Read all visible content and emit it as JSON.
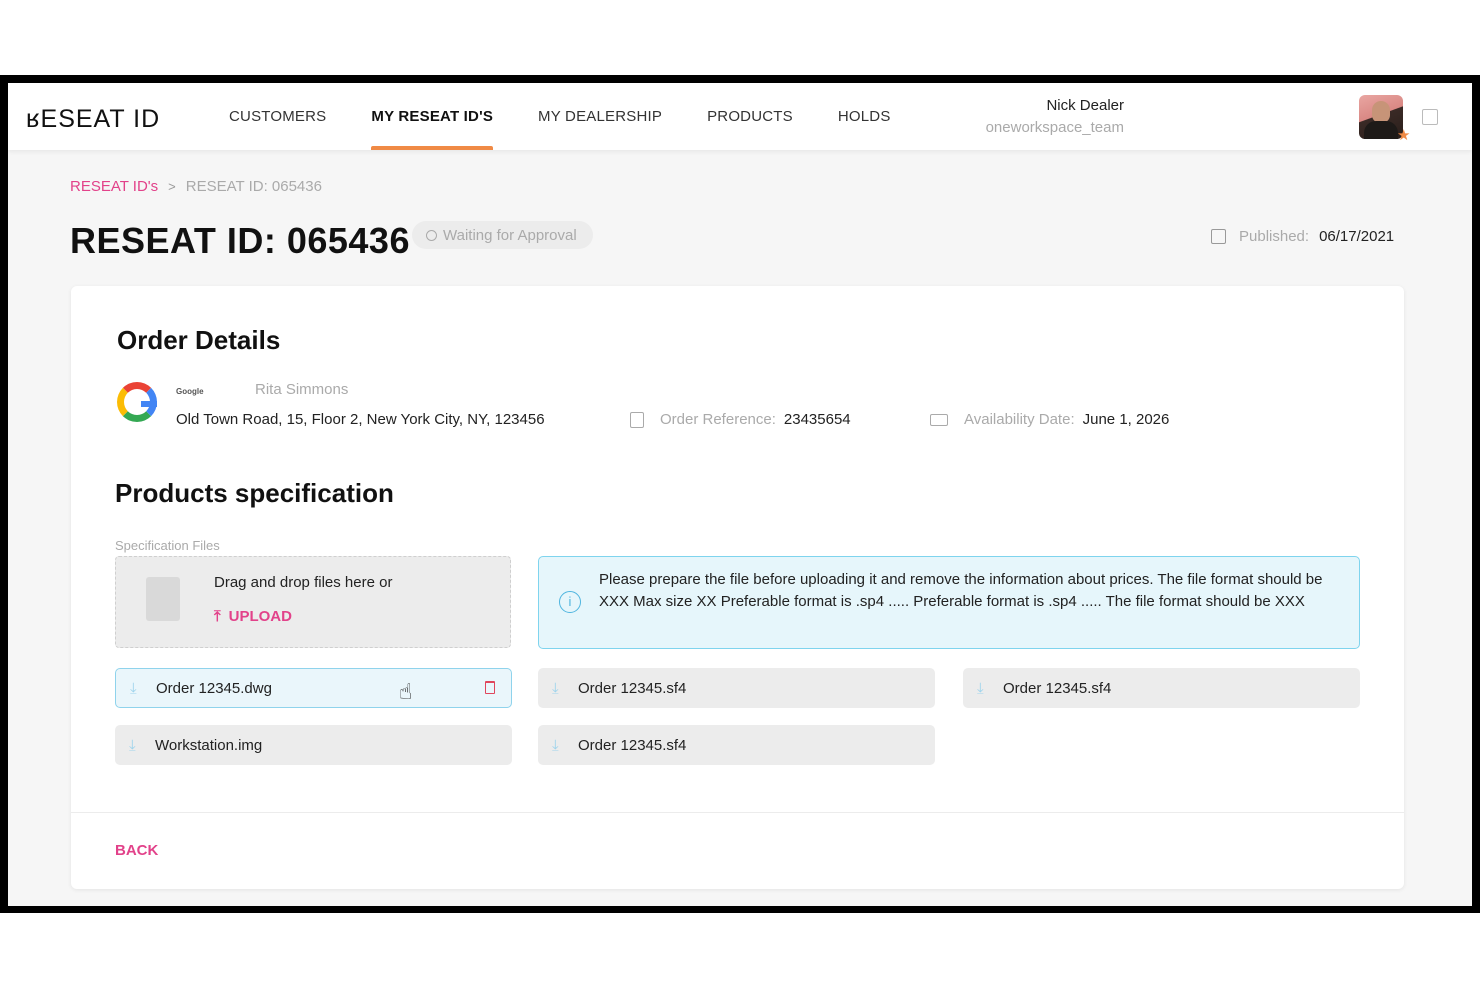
{
  "header": {
    "logo": "ʁESEAT ID",
    "nav": [
      "CUSTOMERS",
      "MY RESEAT ID'S",
      "MY DEALERSHIP",
      "PRODUCTS",
      "HOLDS"
    ],
    "active_nav_index": 1,
    "user_name": "Nick Dealer",
    "user_team": "oneworkspace_team",
    "accent_color": "#f08a45"
  },
  "breadcrumb": {
    "root": "RESEAT ID's",
    "separator": ">",
    "current": "RESEAT ID: 065436"
  },
  "title": "RESEAT ID: 065436",
  "status": "Waiting for Approval",
  "published": {
    "label": "Published:",
    "value": "06/17/2021"
  },
  "order": {
    "heading": "Order Details",
    "company_label": "Google",
    "contact": "Rita Simmons",
    "address": "Old Town Road, 15, Floor 2, New York City, NY, 123456",
    "reference_label": "Order Reference:",
    "reference_value": "23435654",
    "availability_label": "Availability Date:",
    "availability_value": "June 1, 2026"
  },
  "products": {
    "heading": "Products specification",
    "spec_files_label": "Specification Files",
    "drop_text": "Drag and drop files here or",
    "upload_label": "UPLOAD",
    "info_text": "Please prepare the file before uploading it and remove the information about prices. The file format should be XXX Max size XX Preferable format is .sp4 ..... Preferable format is .sp4 ..... The file format should be XXX",
    "files": [
      "Order 12345.dwg",
      "Order 12345.sf4",
      "Order 12345.sf4",
      "Workstation.img",
      "Order 12345.sf4"
    ]
  },
  "footer": {
    "back_label": "BACK"
  },
  "colors": {
    "pink": "#e2428a",
    "info_border": "#7fd4ee",
    "info_bg": "#e6f6fb"
  },
  "icons": [
    "calendar-icon",
    "clock-icon",
    "clipboard-icon",
    "truck-icon",
    "download-icon",
    "trash-icon",
    "info-icon",
    "upload-icon",
    "logout-icon"
  ]
}
